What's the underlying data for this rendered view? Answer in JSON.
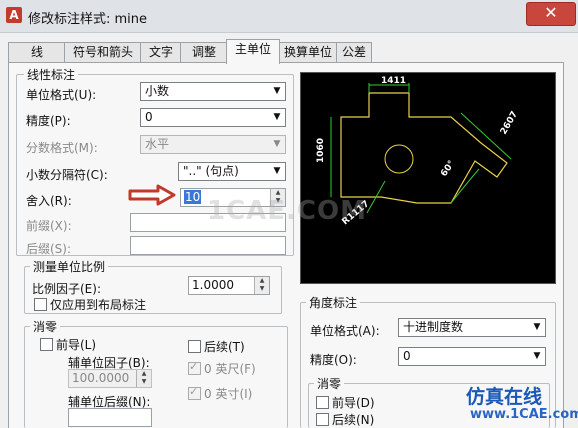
{
  "window": {
    "title": "修改标注样式: mine",
    "app_icon": "A",
    "close_label": "✕"
  },
  "tabs": [
    "线",
    "符号和箭头",
    "文字",
    "调整",
    "主单位",
    "换算单位",
    "公差"
  ],
  "active_tab": 4,
  "linear": {
    "legend": "线性标注",
    "unit_format_label": "单位格式(U):",
    "unit_format_value": "小数",
    "precision_label": "精度(P):",
    "precision_value": "0",
    "fraction_label": "分数格式(M):",
    "fraction_value": "水平",
    "decimal_sep_label": "小数分隔符(C):",
    "decimal_sep_value": "\"..\" (句点)",
    "roundoff_label": "舍入(R):",
    "roundoff_value": "10",
    "prefix_label": "前缀(X):",
    "prefix_value": "",
    "suffix_label": "后缀(S):",
    "suffix_value": ""
  },
  "scale": {
    "legend": "测量单位比例",
    "factor_label": "比例因子(E):",
    "factor_value": "1.0000",
    "layout_only_label": "仅应用到布局标注"
  },
  "zero": {
    "legend": "消零",
    "leading_label": "前导(L)",
    "trailing_label": "后续(T)",
    "sub_factor_label": "辅单位因子(B):",
    "sub_factor_value": "100.0000",
    "sub_suffix_label": "辅单位后缀(N):",
    "feet_label": "0 英尺(F)",
    "inches_label": "0 英寸(I)"
  },
  "angular": {
    "legend": "角度标注",
    "unit_format_label": "单位格式(A):",
    "unit_format_value": "十进制度数",
    "precision_label": "精度(O):",
    "precision_value": "0",
    "zero_legend": "消零",
    "leading_label": "前导(D)",
    "trailing_label": "后续(N)"
  },
  "preview_dims": {
    "top": "1411",
    "left": "1060",
    "right": "2607",
    "angle": "60°",
    "radius": "R1117"
  },
  "watermark": {
    "center": "1CAE.COM",
    "brand_cn": "仿真在线",
    "brand_url": "www.1CAE.com"
  },
  "colors": {
    "close": "#c9463d",
    "arrow": "#c0392b",
    "preview_bg": "#000000",
    "dim": "#ffffff",
    "shape": "#e8d24a",
    "leader": "#33cc33"
  }
}
